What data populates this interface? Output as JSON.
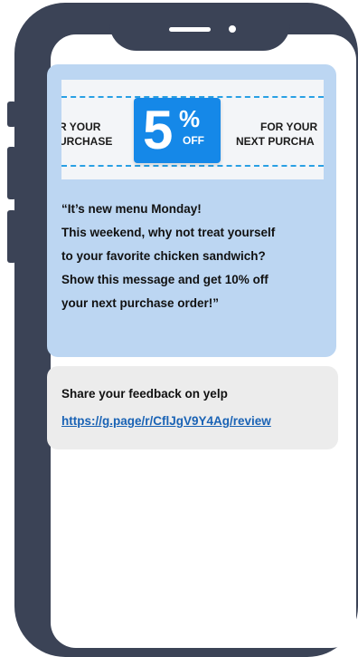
{
  "coupon": {
    "left_text": [
      "R YOUR",
      "URCHASE"
    ],
    "badge_number": "5",
    "badge_percent": "%",
    "badge_off": "OFF",
    "right_text": [
      "FOR YOUR",
      "NEXT PURCHA"
    ],
    "accent": "#1588e8"
  },
  "message": {
    "lines": [
      "“It’s new menu Monday!",
      "This weekend, why not treat yourself",
      "to your favorite chicken sandwich?",
      "Show  this message and get 10% off",
      "your next purchase order!”"
    ],
    "bubble_color": "#bcd6f2"
  },
  "feedback": {
    "text": "Share your feedback on yelp",
    "link": "https://g.page/r/CflJgV9Y4Ag/review",
    "bubble_color": "#ececec"
  },
  "phone": {
    "frame_color": "#3b4356"
  }
}
